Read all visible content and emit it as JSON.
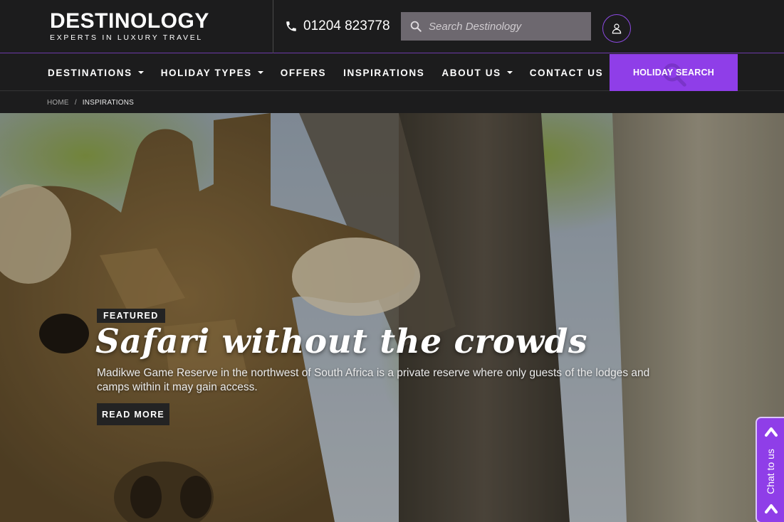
{
  "header": {
    "logo_main": "DESTINOLOGY",
    "logo_sub": "EXPERTS IN LUXURY TRAVEL",
    "phone": "01204 823778",
    "search_placeholder": "Search Destinology"
  },
  "nav": {
    "items": [
      {
        "label": "DESTINATIONS",
        "dropdown": true
      },
      {
        "label": "HOLIDAY TYPES",
        "dropdown": true
      },
      {
        "label": "OFFERS",
        "dropdown": false
      },
      {
        "label": "INSPIRATIONS",
        "dropdown": false
      },
      {
        "label": "ABOUT US",
        "dropdown": true
      },
      {
        "label": "CONTACT US",
        "dropdown": false
      }
    ],
    "holiday_search": "HOLIDAY SEARCH"
  },
  "breadcrumb": {
    "home": "HOME",
    "separator": "/",
    "current": "INSPIRATIONS"
  },
  "hero": {
    "badge": "FEATURED",
    "title": "Safari without the crowds",
    "description": "Madikwe Game Reserve in the northwest of South Africa is a private reserve where only guests of the lodges and camps within it may gain access.",
    "button": "READ MORE"
  },
  "chat": {
    "label": "Chat to us"
  },
  "colors": {
    "accent": "#8f3ee8",
    "header_bg": "#1c1c1d",
    "search_bg": "#6d686f"
  }
}
